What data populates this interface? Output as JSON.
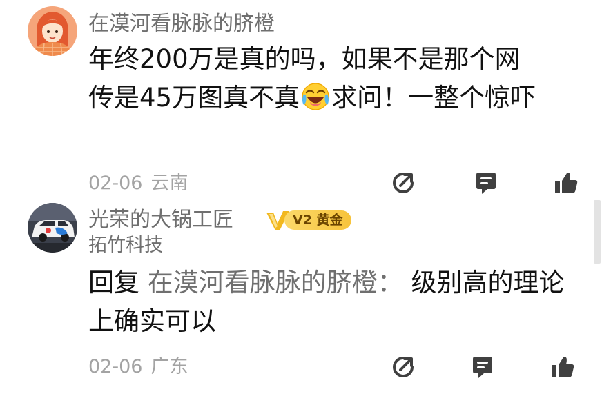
{
  "comments": [
    {
      "username": "在漠河看脉脉的脐橙",
      "text_line1": "年终200万是真的吗，如果不是那个网",
      "text_line2_before_emoji": "传是45万图真不真",
      "emoji": "laughing-crying-emoji",
      "text_line2_after_emoji": "求问！一整个惊吓",
      "date": "02-06",
      "region": "云南"
    },
    {
      "username": "光荣的大锅工匠",
      "badge_label": "V2 黄金",
      "company": "拓竹科技",
      "reply_prefix": "回复 ",
      "reply_target": "在漠河看脉脉的脐橙：",
      "reply_text": " 级别高的理论上确实可以",
      "date": "02-06",
      "region": "广东"
    }
  ],
  "actions": {
    "share_icon": "share-arrow-icon",
    "comment_icon": "comment-bubble-icon",
    "like_icon": "thumbs-up-icon"
  },
  "colors": {
    "primary_text": "#111111",
    "secondary_text": "#6f6f6f",
    "meta_text": "#a3a3a3",
    "badge_gold": "#f7c33b",
    "icon_dark": "#404040"
  }
}
